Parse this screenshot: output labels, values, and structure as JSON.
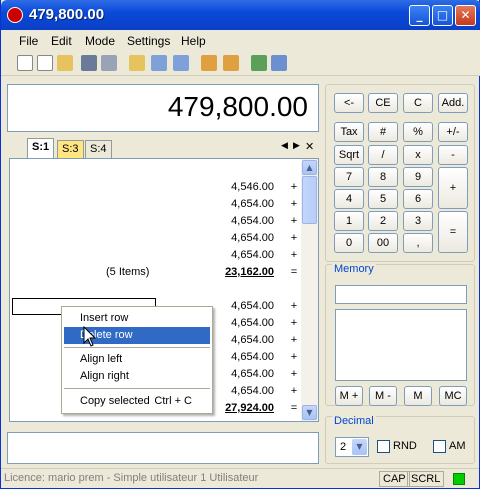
{
  "window": {
    "title": "479,800.00",
    "minimize": "_",
    "maximize": "□",
    "close": "✕"
  },
  "menu": [
    "File",
    "Edit",
    "Mode",
    "Settings",
    "Help"
  ],
  "display": {
    "value": "479,800.00"
  },
  "tabs": [
    {
      "label": "S:1",
      "active": true,
      "color": "#ffffff"
    },
    {
      "label": "S:3",
      "active": false,
      "color": "#ffe680"
    },
    {
      "label": "S:4",
      "active": false,
      "color": "#ece9d8"
    }
  ],
  "tab_controls": {
    "prev": "◀",
    "next": "▶",
    "close": "✕"
  },
  "rows_top": [
    {
      "value": "4,546.00",
      "op": "+"
    },
    {
      "value": "4,654.00",
      "op": "+"
    },
    {
      "value": "4,654.00",
      "op": "+"
    },
    {
      "value": "4,654.00",
      "op": "+"
    },
    {
      "value": "4,654.00",
      "op": "+"
    }
  ],
  "subtotal": {
    "label": "(5 Items)",
    "value": "23,162.00",
    "op": "="
  },
  "rows_bottom": [
    {
      "value": "4,654.00",
      "op": "+"
    },
    {
      "value": "4,654.00",
      "op": "+"
    },
    {
      "value": "4,654.00",
      "op": "+"
    },
    {
      "value": "4,654.00",
      "op": "+"
    },
    {
      "value": "4,654.00",
      "op": "+"
    },
    {
      "value": "4,654.00",
      "op": "+"
    }
  ],
  "total": {
    "value": "27,924.00",
    "op": "="
  },
  "context_menu": {
    "insert": "Insert row",
    "delete": "Delete row",
    "align_left": "Align left",
    "align_right": "Align right",
    "copy": "Copy selected",
    "copy_shortcut": "Ctrl + C"
  },
  "keys": {
    "back": "<-",
    "ce": "CE",
    "c": "C",
    "add": "Add.",
    "tax": "Tax",
    "hash": "#",
    "percent": "%",
    "plusminus": "+/-",
    "sqrt": "Sqrt",
    "div": "/",
    "mul": "x",
    "minus": "-",
    "k7": "7",
    "k8": "8",
    "k9": "9",
    "plus": "+",
    "k4": "4",
    "k5": "5",
    "k6": "6",
    "k1": "1",
    "k2": "2",
    "k3": "3",
    "equals": "=",
    "k0": "0",
    "k00": "00",
    "dot": ","
  },
  "memory": {
    "title": "Memory",
    "mplus": "M +",
    "mminus": "M -",
    "m": "M",
    "mc": "MC"
  },
  "decimal": {
    "title": "Decimal",
    "value": "2",
    "rnd": "RND",
    "am": "AM"
  },
  "status": {
    "licence": "Licence: mario prem - Simple utilisateur 1 Utilisateur",
    "cap": "CAP",
    "scrl": "SCRL",
    "indicator_color": "#00cc00"
  }
}
